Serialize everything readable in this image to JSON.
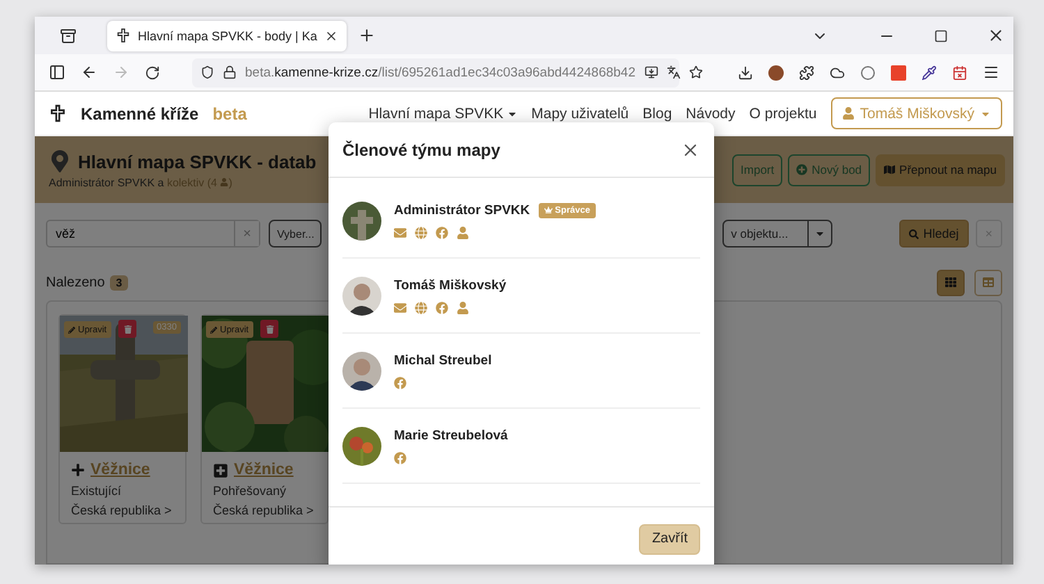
{
  "browser": {
    "tab_title": "Hlavní mapa SPVKK - body | Ka",
    "url": "beta.**kamenne-krize.cz**/list/695261ad1ec34c03a96abd4424868b42"
  },
  "navbar": {
    "brand": "Kamenné kříže",
    "brand_tag": "beta",
    "items": [
      {
        "label": "Hlavní mapa SPVKK",
        "dropdown": true
      },
      {
        "label": "Mapy uživatelů",
        "dropdown": false
      },
      {
        "label": "Blog",
        "dropdown": false
      },
      {
        "label": "Návody",
        "dropdown": false
      },
      {
        "label": "O projektu",
        "dropdown": false
      }
    ],
    "user": "Tomáš Miškovský"
  },
  "header": {
    "title": "Hlavní mapa SPVKK - datab",
    "owner": "Administrátor SPVKK a",
    "team_link": "kolektiv (4",
    "team_link_end": ")",
    "actions": [
      {
        "label": "Import",
        "kind": "outline"
      },
      {
        "label": "Nový bod",
        "kind": "outline"
      },
      {
        "label": "Přepnout na mapu",
        "kind": "solid"
      }
    ]
  },
  "filters": {
    "search_value": "věž",
    "clear": "×",
    "select_placeholder": "Vyber...",
    "object_placeholder": "v objektu...",
    "search_button": "Hledej",
    "reset": "×"
  },
  "results": {
    "label": "Nalezeno",
    "count": "3",
    "views": [
      {
        "selected": true
      },
      {
        "selected": false
      }
    ]
  },
  "cards": [
    {
      "edit": "Upravit",
      "code": "0330",
      "kind": "cross",
      "title": "Věžnice",
      "status": "Existující",
      "location": "Česká republika >"
    },
    {
      "edit": "Upravit",
      "kind": "boxed-cross",
      "title": "Věžnice",
      "status": "Pohřešovaný",
      "location": "Česká republika >"
    }
  ],
  "modal": {
    "title": "Členové týmu mapy",
    "members": [
      {
        "name": "Administrátor SPVKK",
        "role": "Správce",
        "links": [
          {
            "kind": "email"
          },
          {
            "kind": "web"
          },
          {
            "kind": "facebook"
          },
          {
            "kind": "profile"
          }
        ]
      },
      {
        "name": "Tomáš Miškovský",
        "links": [
          {
            "kind": "email"
          },
          {
            "kind": "web"
          },
          {
            "kind": "facebook"
          },
          {
            "kind": "profile"
          }
        ]
      },
      {
        "name": "Michal Streubel",
        "links": [
          {
            "kind": "facebook"
          }
        ]
      },
      {
        "name": "Marie Streubelová",
        "links": [
          {
            "kind": "facebook"
          }
        ]
      }
    ],
    "close_button": "Zavřít"
  }
}
